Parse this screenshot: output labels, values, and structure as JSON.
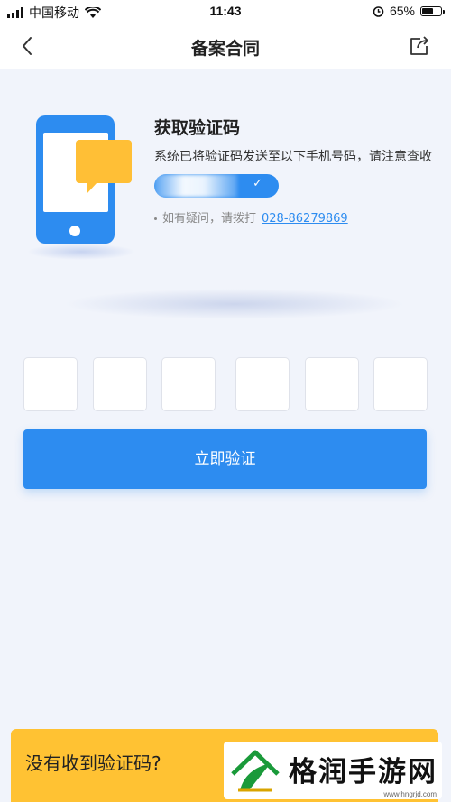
{
  "status_bar": {
    "carrier": "中国移动",
    "time": "11:43",
    "battery_percent": "65%",
    "battery_level": 0.65
  },
  "nav": {
    "title": "备案合同",
    "back_icon": "chevron-left-icon",
    "share_icon": "share-icon"
  },
  "verify": {
    "heading": "获取验证码",
    "description": "系统已将验证码发送至以下手机号码，请注意查收",
    "help_prefix": "如有疑问，请拨打",
    "help_phone": "028-86279869"
  },
  "code_input": {
    "length": 6,
    "values": [
      "",
      "",
      "",
      "",
      "",
      ""
    ]
  },
  "buttons": {
    "verify_now": "立即验证"
  },
  "banner": {
    "no_code": "没有收到验证码?"
  },
  "watermark": {
    "text": "格润手游网",
    "url": "www.hngrjd.com"
  },
  "colors": {
    "primary": "#2d8cf0",
    "accent": "#ffbf36",
    "background": "#f1f4fb"
  }
}
